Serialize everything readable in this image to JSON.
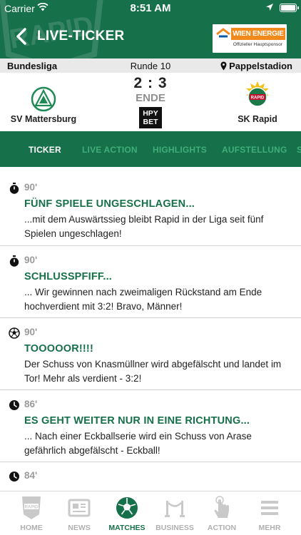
{
  "status_bar": {
    "carrier": "Carrier",
    "time": "8:51 AM"
  },
  "header": {
    "title": "LIVE-TICKER",
    "sponsor_name": "WIEN ENERGIE",
    "sponsor_sub": "Offizieller Hauptsponsor"
  },
  "match": {
    "league": "Bundesliga",
    "round": "Runde 10",
    "venue": "Pappelstadion",
    "home_team": "SV Mattersburg",
    "away_team": "SK Rapid",
    "score": "2 : 3",
    "status": "ENDE",
    "betting_line1": "HPY",
    "betting_line2": "BET"
  },
  "tabs": [
    {
      "label": "TICKER",
      "active": true
    },
    {
      "label": "LIVE ACTION",
      "active": false
    },
    {
      "label": "HIGHLIGHTS",
      "active": false
    },
    {
      "label": "AUFSTELLUNG",
      "active": false
    },
    {
      "label": "S",
      "active": false
    }
  ],
  "entries": [
    {
      "icon": "stopwatch-icon",
      "minute": "90'",
      "title": "FÜNF SPIELE UNGESCHLAGEN...",
      "text": "...mit dem Auswärtssieg bleibt Rapid in der Liga seit fünf Spielen ungeschlagen!"
    },
    {
      "icon": "stopwatch-icon",
      "minute": "90'",
      "title": "SCHLUSSPFIFF...",
      "text": "... Wir gewinnen nach zweimaligen Rückstand am Ende hochverdient mit 3:2! Bravo, Männer!"
    },
    {
      "icon": "soccer-ball-icon",
      "minute": "90'",
      "title": "TOOOOOR!!!!",
      "text": "Der Schuss von Knasmüllner wird abgefälscht und landet im Tor! Mehr als verdient - 3:2!"
    },
    {
      "icon": "clock-icon",
      "minute": "86'",
      "title": "ES GEHT WEITER NUR IN EINE RICHTUNG...",
      "text": "... Nach einer Eckballserie wird ein Schuss von Arase gefährlich abgefälscht - Eckball!"
    },
    {
      "icon": "clock-icon",
      "minute": "84'",
      "title": "",
      "text": ""
    }
  ],
  "nav": [
    {
      "label": "HOME",
      "icon": "rapid-crest-icon",
      "active": false
    },
    {
      "label": "NEWS",
      "icon": "newspaper-icon",
      "active": false
    },
    {
      "label": "MATCHES",
      "icon": "soccer-ball-icon",
      "active": true
    },
    {
      "label": "BUSINESS",
      "icon": "vip-barrier-icon",
      "active": false
    },
    {
      "label": "ACTION",
      "icon": "touch-hand-icon",
      "active": false
    },
    {
      "label": "MEHR",
      "icon": "menu-icon",
      "active": false
    }
  ],
  "colors": {
    "brand_green": "#16704a",
    "tab_inactive": "#3fae78",
    "sponsor_orange": "#f08a1c"
  }
}
